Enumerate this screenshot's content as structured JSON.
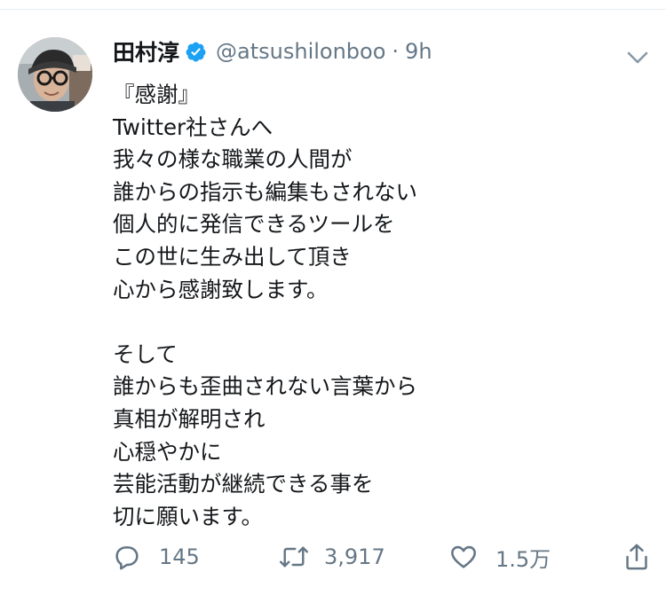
{
  "tweet": {
    "author": {
      "display_name": "田村淳",
      "verified": true,
      "handle": "@atsushilonboo",
      "separator": "·",
      "time": "9h"
    },
    "text_lines": [
      "『感謝』",
      "Twitter社さんへ",
      "我々の様な職業の人間が",
      "誰からの指示も編集もされない",
      "個人的に発信できるツールを",
      "この世に生み出して頂き",
      "心から感謝致します。",
      "",
      "そして",
      "誰からも歪曲されない言葉から",
      "真相が解明され",
      "心穏やかに",
      "芸能活動が継続できる事を",
      "切に願います。"
    ],
    "actions": {
      "reply": {
        "icon": "reply-icon",
        "count": "145"
      },
      "retweet": {
        "icon": "retweet-icon",
        "count": "3,917"
      },
      "like": {
        "icon": "heart-icon",
        "count": "1.5万"
      },
      "share": {
        "icon": "share-icon"
      }
    }
  },
  "colors": {
    "text_primary": "#14171a",
    "text_secondary": "#657786",
    "verified_blue": "#1da1f2",
    "divider": "#e6ecf0"
  }
}
